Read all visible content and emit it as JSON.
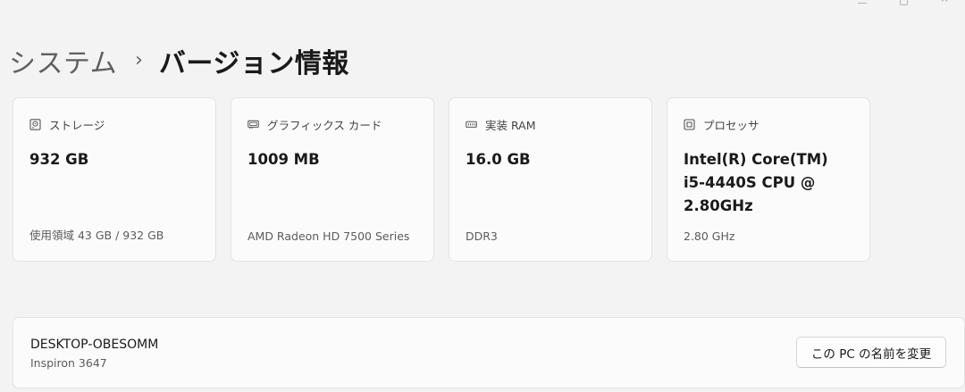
{
  "breadcrumb": {
    "parent": "システム",
    "separator": "›",
    "current": "バージョン情報"
  },
  "cards": [
    {
      "icon": "storage-icon",
      "label": "ストレージ",
      "value": "932 GB",
      "sub": "使用領域 43 GB / 932 GB"
    },
    {
      "icon": "graphics-card-icon",
      "label": "グラフィックス カード",
      "value": "1009 MB",
      "sub": "AMD Radeon HD 7500 Series"
    },
    {
      "icon": "ram-icon",
      "label": "実装 RAM",
      "value": "16.0 GB",
      "sub": "DDR3"
    },
    {
      "icon": "processor-icon",
      "label": "プロセッサ",
      "value": "Intel(R) Core(TM) i5-4440S CPU @ 2.80GHz",
      "sub": "2.80 GHz"
    }
  ],
  "device": {
    "name": "DESKTOP-OBESOMM",
    "model": "Inspiron 3647",
    "rename_label": "この PC の名前を変更"
  },
  "colors": {
    "background": "#f3f3f3",
    "card": "#fbfbfb",
    "border": "#e3e3e3"
  }
}
